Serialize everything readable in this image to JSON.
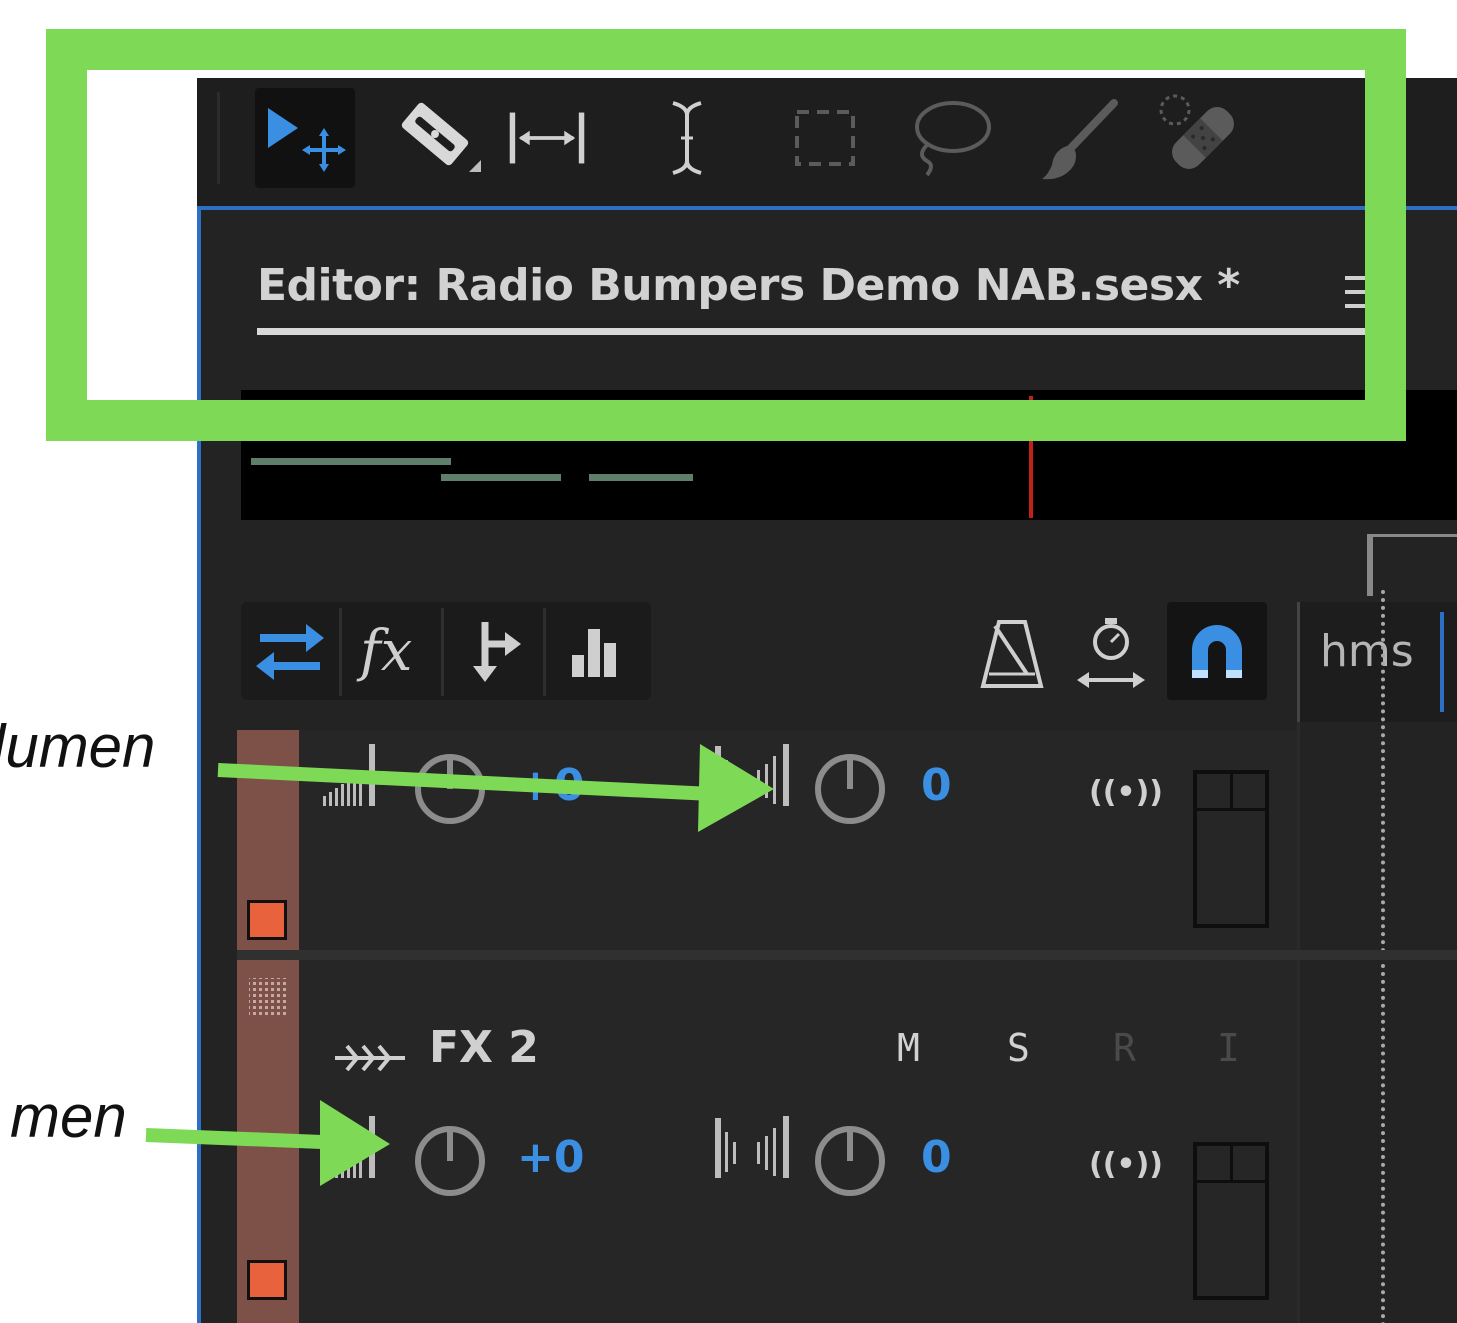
{
  "toolbar": {
    "tools": [
      {
        "name": "move-tool",
        "active": true
      },
      {
        "name": "razor-tool",
        "active": false
      },
      {
        "name": "slip-tool",
        "active": false
      },
      {
        "name": "time-selection-tool",
        "active": false
      },
      {
        "name": "marquee-tool",
        "active": false
      },
      {
        "name": "lasso-tool",
        "active": false
      },
      {
        "name": "brush-tool",
        "active": false
      },
      {
        "name": "spot-healing-tool",
        "active": false
      }
    ]
  },
  "editor": {
    "tab_title": "Editor: Radio Bumpers Demo NAB.sesx *"
  },
  "controls": {
    "ruler_label": "hms"
  },
  "tracks": [
    {
      "name": "",
      "volume_value": "+0",
      "pan_value": "0",
      "color": "#7d5048"
    },
    {
      "name": "FX 2",
      "volume_value": "+0",
      "pan_value": "0",
      "m": "M",
      "s": "S",
      "r": "R",
      "i": "I",
      "color": "#7d5048"
    }
  ],
  "annotations": {
    "label_1": "lumen",
    "label_2": "men",
    "highlight_color": "#7ed957"
  },
  "colors": {
    "accent": "#3b8fe3",
    "panel_border": "#2d6fc4",
    "playhead": "#c0211b",
    "clip": "#5e7f6c",
    "track_swatch": "#e9623e"
  }
}
